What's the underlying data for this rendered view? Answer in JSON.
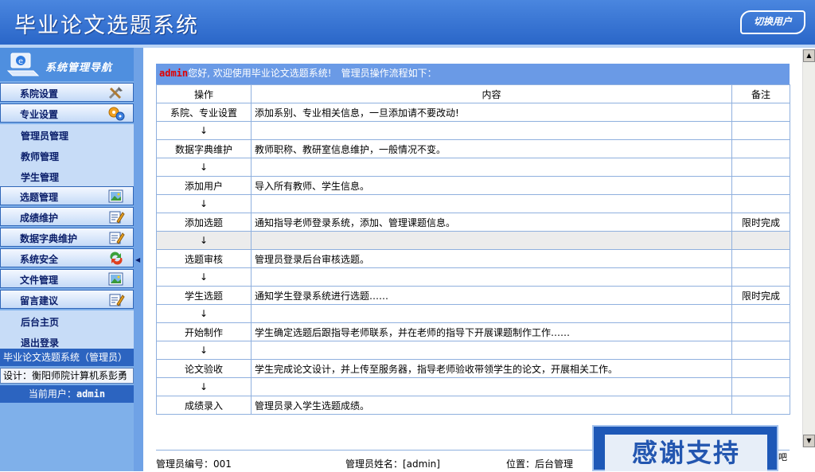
{
  "header": {
    "title": "毕业论文选题系统",
    "switch_user": "切换用户"
  },
  "sidebar": {
    "nav_title": "系统管理导航",
    "items": [
      {
        "label": "系院设置",
        "type": "main",
        "icon": "tools-icon"
      },
      {
        "label": "专业设置",
        "type": "main",
        "icon": "gears-icon"
      },
      {
        "label": "管理员管理",
        "type": "sub"
      },
      {
        "label": "教师管理",
        "type": "sub"
      },
      {
        "label": "学生管理",
        "type": "sub"
      },
      {
        "label": "选题管理",
        "type": "main",
        "icon": "picture-icon"
      },
      {
        "label": "成绩维护",
        "type": "main",
        "icon": "edit-icon"
      },
      {
        "label": "数据字典维护",
        "type": "main",
        "icon": "edit-icon"
      },
      {
        "label": "系统安全",
        "type": "main",
        "icon": "refresh-icon"
      },
      {
        "label": "文件管理",
        "type": "main",
        "icon": "picture-icon"
      },
      {
        "label": "留言建议",
        "type": "main",
        "icon": "edit-icon"
      },
      {
        "label": "后台主页",
        "type": "sub"
      },
      {
        "label": "退出登录",
        "type": "sub"
      }
    ],
    "system_name": "毕业论文选题系统（管理员）",
    "designer": "设计：衡阳师院计算机系彭勇",
    "current_user_label": "当前用户：",
    "current_user": "admin"
  },
  "welcome": {
    "user": "admin",
    "text": "您好, 欢迎使用毕业论文选题系统!　管理员操作流程如下："
  },
  "table": {
    "headers": [
      "操作",
      "内容",
      "备注"
    ],
    "rows": [
      {
        "op": "系院、专业设置",
        "content": "添加系别、专业相关信息，一旦添加请不要改动!",
        "note": ""
      },
      {
        "op": "↓",
        "content": "",
        "note": ""
      },
      {
        "op": "数据字典维护",
        "content": "教师职称、教研室信息维护，一般情况不变。",
        "note": ""
      },
      {
        "op": "↓",
        "content": "",
        "note": ""
      },
      {
        "op": "添加用户",
        "content": "导入所有教师、学生信息。",
        "note": ""
      },
      {
        "op": "↓",
        "content": "",
        "note": ""
      },
      {
        "op": "添加选题",
        "content": "通知指导老师登录系统，添加、管理课题信息。",
        "note": "限时完成"
      },
      {
        "op": "↓",
        "content": "",
        "note": "",
        "gray": true
      },
      {
        "op": "选题审核",
        "content": "管理员登录后台审核选题。",
        "note": ""
      },
      {
        "op": "↓",
        "content": "",
        "note": ""
      },
      {
        "op": "学生选题",
        "content": "通知学生登录系统进行选题……",
        "note": "限时完成"
      },
      {
        "op": "↓",
        "content": "",
        "note": ""
      },
      {
        "op": "开始制作",
        "content": "学生确定选题后跟指导老师联系，并在老师的指导下开展课题制作工作……",
        "note": ""
      },
      {
        "op": "↓",
        "content": "",
        "note": ""
      },
      {
        "op": "论文验收",
        "content": "学生完成论文设计，并上传至服务器，指导老师验收带领学生的论文，开展相关工作。",
        "note": ""
      },
      {
        "op": "↓",
        "content": "",
        "note": ""
      },
      {
        "op": "成绩录入",
        "content": "管理员录入学生选题成绩。",
        "note": ""
      }
    ]
  },
  "footer": {
    "admin_id": "管理员编号：001",
    "admin_name": "管理员姓名：[admin]",
    "location": "位置：后台管理"
  },
  "thanks_banner": "感谢支持",
  "edge_text": "吧"
}
